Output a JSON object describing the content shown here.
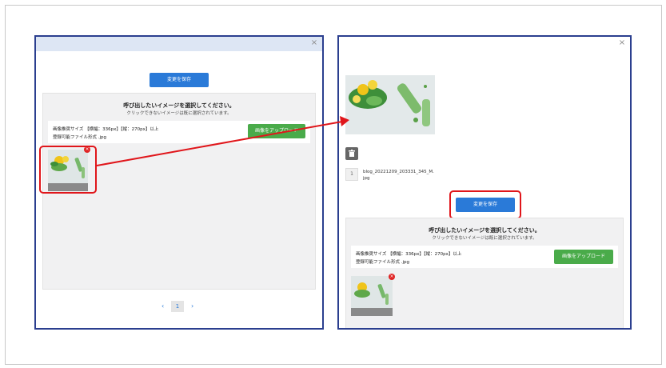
{
  "left_dialog": {
    "close_glyph": "×",
    "save_label": "変更を保存",
    "panel_title": "呼び出したいイメージを選択してください。",
    "panel_subtitle": "クリックできないイメージは既に選択されています。",
    "size_line": "画像推奨サイズ 【横幅：336px】【縦：270px】以上",
    "format_line": "登録可能ファイル形式 .jpg",
    "upload_label": "画像をアップロード",
    "pager": {
      "prev": "‹",
      "page": "1",
      "next": "›"
    }
  },
  "right_dialog": {
    "close_glyph": "×",
    "file_index": "1",
    "file_name": "blog_20221209_203331_345_M.jpg",
    "save_label": "変更を保存",
    "panel_title": "呼び出したいイメージを選択してください。",
    "panel_subtitle": "クリックできないイメージは既に選択されています。",
    "size_line": "画像推奨サイズ 【横幅：336px】【縦：270px】以上",
    "format_line": "登録可能ファイル形式 .jpg",
    "upload_label": "画像をアップロード"
  },
  "thumb_remove_glyph": "×",
  "colors": {
    "dialog_border": "#2b3f8f",
    "header_bg": "#dde6f4",
    "save_button": "#2a7ad8",
    "upload_button": "#4aab4a",
    "highlight": "#e0161b"
  }
}
